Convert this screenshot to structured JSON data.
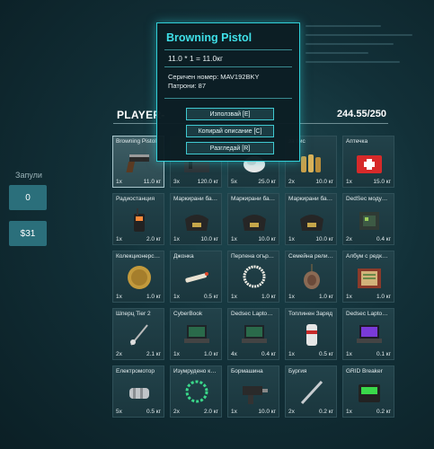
{
  "left_panel": {
    "title": "Запули",
    "count_btn": "0",
    "money_btn": "$31"
  },
  "header": {
    "player": "PLAYER-",
    "weight": "244.55/250"
  },
  "tooltip": {
    "title": "Browning Pistol",
    "formula": "11.0 * 1 = 11.0кг",
    "serial": "Серичен номер: MAV192BKY",
    "ammo": "Патрони: 87",
    "buttons": [
      "Използвай [E]",
      "Копирай описание [C]",
      "Разгледай [R]"
    ]
  },
  "items": [
    {
      "name": "Browning Pistol",
      "qty": "1x",
      "wt": "11.0 кг",
      "icon": "pistol-icon",
      "selected": true
    },
    {
      "name": "",
      "qty": "3x",
      "wt": "120.0 кг",
      "icon": "crate-icon"
    },
    {
      "name": "",
      "qty": "5x",
      "wt": "25.0 кг",
      "icon": "cloth-icon"
    },
    {
      "name": "за пис",
      "qty": "2x",
      "wt": "10.0 кг",
      "icon": "ammo-icon"
    },
    {
      "name": "Аптечка",
      "qty": "1x",
      "wt": "15.0 кг",
      "icon": "medkit-icon"
    },
    {
      "name": "Радиостанция",
      "qty": "1x",
      "wt": "2.0 кг",
      "icon": "radio-icon"
    },
    {
      "name": "Маркирани банк...",
      "qty": "1x",
      "wt": "10.0 кг",
      "icon": "money-bag-icon"
    },
    {
      "name": "Маркирани банк...",
      "qty": "1x",
      "wt": "10.0 кг",
      "icon": "money-bag-icon"
    },
    {
      "name": "Маркирани банк...",
      "qty": "1x",
      "wt": "10.0 кг",
      "icon": "money-bag-icon"
    },
    {
      "name": "DedSec модул G...",
      "qty": "2x",
      "wt": "0.4 кг",
      "icon": "module-icon"
    },
    {
      "name": "Колекционерска...",
      "qty": "1x",
      "wt": "1.0 кг",
      "icon": "coin-icon"
    },
    {
      "name": "Джонка",
      "qty": "1x",
      "wt": "0.5 кг",
      "icon": "joint-icon"
    },
    {
      "name": "Перлена огърли...",
      "qty": "1x",
      "wt": "1.0 кг",
      "icon": "pearl-necklace-icon"
    },
    {
      "name": "Семейна реликва",
      "qty": "1x",
      "wt": "1.0 кг",
      "icon": "pendant-icon"
    },
    {
      "name": "Албум с редки ...",
      "qty": "1x",
      "wt": "1.0 кг",
      "icon": "album-icon"
    },
    {
      "name": "Шперц Tier 2",
      "qty": "2x",
      "wt": "2.1 кг",
      "icon": "lockpick-icon"
    },
    {
      "name": "CyberBook",
      "qty": "1x",
      "wt": "1.0 кг",
      "icon": "laptop-icon"
    },
    {
      "name": "Dedsec Laptop ...",
      "qty": "4x",
      "wt": "0.4 кг",
      "icon": "laptop-icon"
    },
    {
      "name": "Топлинен Заряд",
      "qty": "1x",
      "wt": "0.5 кг",
      "icon": "thermite-icon"
    },
    {
      "name": "Dedsec Laptop ...",
      "qty": "1x",
      "wt": "0.1 кг",
      "icon": "laptop-purple-icon"
    },
    {
      "name": "Електромотор",
      "qty": "5x",
      "wt": "0.5 кг",
      "icon": "motor-icon"
    },
    {
      "name": "Изумрудено кол...",
      "qty": "2x",
      "wt": "2.0 кг",
      "icon": "emerald-necklace-icon"
    },
    {
      "name": "Бормашина",
      "qty": "1x",
      "wt": "10.0 кг",
      "icon": "drill-icon"
    },
    {
      "name": "Бургия",
      "qty": "2x",
      "wt": "0.2 кг",
      "icon": "drill-bit-icon"
    },
    {
      "name": "GRID Breaker",
      "qty": "1x",
      "wt": "0.2 кг",
      "icon": "grid-breaker-icon"
    }
  ]
}
